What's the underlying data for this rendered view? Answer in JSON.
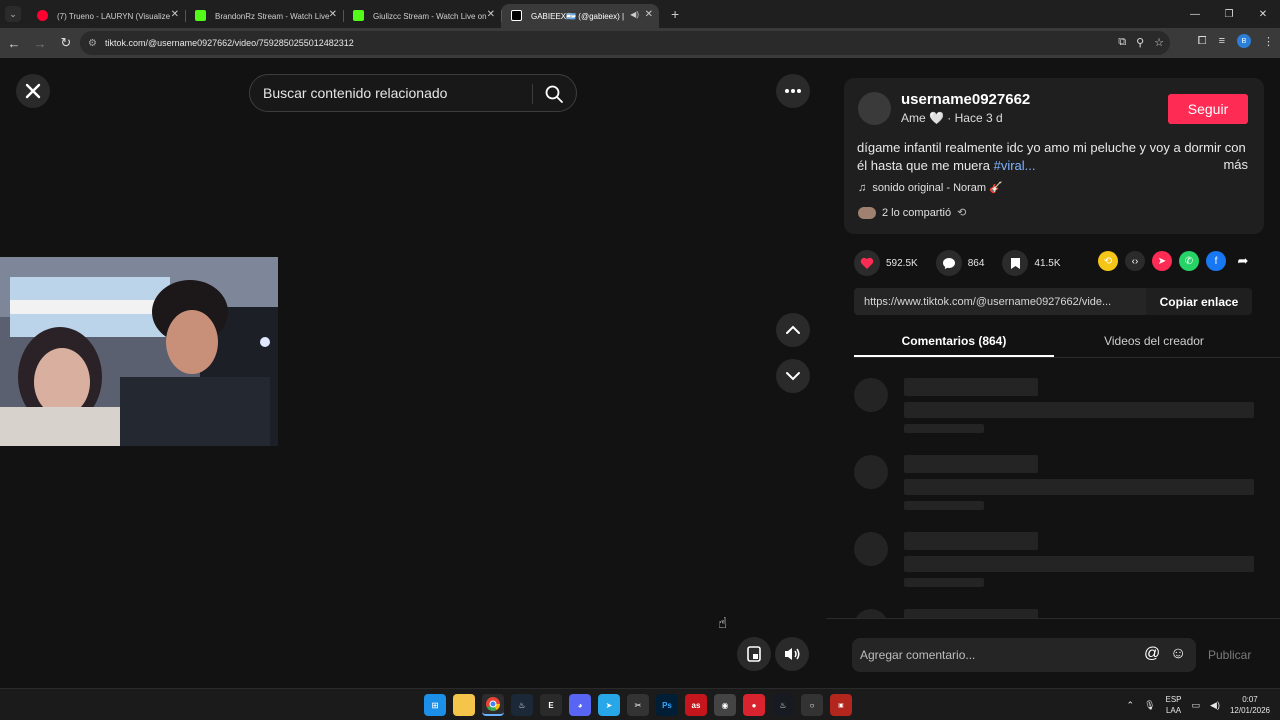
{
  "browser": {
    "tabs": [
      {
        "title": "(7) Trueno - LAURYN (Visualize",
        "favicon_color": "#ff0033",
        "active": false
      },
      {
        "title": "BrandonRz Stream - Watch Live",
        "favicon_color": "#53fc18",
        "active": false
      },
      {
        "title": "Giulizcc Stream - Watch Live on",
        "favicon_color": "#53fc18",
        "active": false
      },
      {
        "title": "GABIEEX🇦🇷 (@gabieex) |",
        "favicon_color": "#ffffff",
        "active": true
      }
    ],
    "url": "tiktok.com/@username0927662/video/7592850255012482312"
  },
  "search": {
    "placeholder": "Buscar contenido relacionado"
  },
  "post": {
    "username": "username0927662",
    "meta": "Ame 🤍 · Hace 3 d",
    "follow_label": "Seguir",
    "description": "dígame infantil realmente idc yo amo mi peluche y voy a dormir con él hasta que me muera",
    "hashtag": "#viral...",
    "more_label": "más",
    "music": "sonido original - Noram 🎸",
    "shared": "2 lo compartió"
  },
  "stats": {
    "likes": "592.5K",
    "comments": "864",
    "saves": "41.5K"
  },
  "link": {
    "url": "https://www.tiktok.com/@username0927662/vide...",
    "copy_label": "Copiar enlace"
  },
  "panel_tabs": {
    "comments": "Comentarios (864)",
    "creator": "Videos del creador"
  },
  "comment_box": {
    "placeholder": "Agregar comentario...",
    "post_label": "Publicar"
  },
  "taskbar": {
    "lang": "ESP",
    "layout": "LAA",
    "time": "0:07",
    "date": "12/01/2026"
  },
  "colors": {
    "accent": "#fe2c55",
    "hashtag": "#80b4ff"
  }
}
